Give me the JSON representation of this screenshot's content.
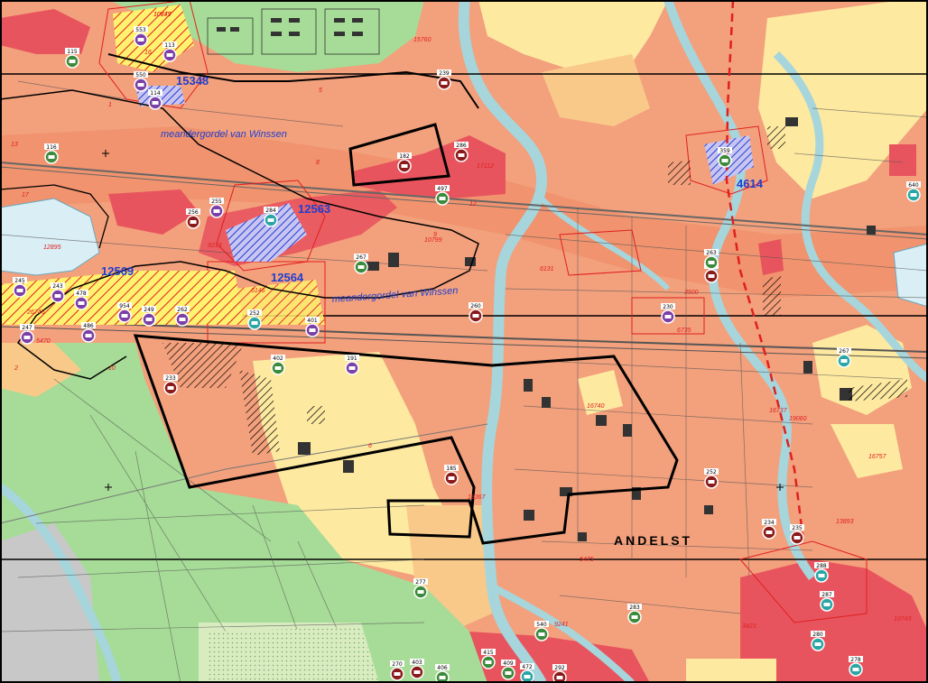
{
  "colors": {
    "zone_salmon": "#f3a07c",
    "zone_dark_salmon": "#ee8a66",
    "zone_red": "#e8545e",
    "zone_orange": "#f9c98a",
    "zone_yellow": "#fde9a0",
    "zone_green": "#a6dc97",
    "zone_light_green": "#c6e8b0",
    "zone_grey": "#c8c8c8",
    "water": "#a6d5dc",
    "lake": "#d9eef5",
    "marker_dark_red": "#8b1a1a",
    "marker_purple": "#7b3fa8",
    "marker_teal": "#2aa6a6",
    "marker_green": "#3c8a3c",
    "blue_label": "#1f3fd0",
    "red_label": "#e02020"
  },
  "labels": {
    "river_top": "meandergordel van Winssen",
    "river_mid": "meandergordel van Winssen",
    "town": "ANDELST",
    "ids": {
      "a": "15348",
      "b": "12563",
      "c": "12569",
      "d": "12564",
      "e": "4614"
    }
  },
  "markers": [
    {
      "id": "m1",
      "label": "115",
      "color": "marker_green"
    },
    {
      "id": "m2",
      "label": "553",
      "color": "marker_purple"
    },
    {
      "id": "m3",
      "label": "113",
      "color": "marker_purple"
    },
    {
      "id": "m4",
      "label": "550",
      "color": "marker_purple"
    },
    {
      "id": "m5",
      "label": "114",
      "color": "marker_purple"
    },
    {
      "id": "m6",
      "label": "239",
      "color": "marker_dark_red"
    },
    {
      "id": "m7",
      "label": "116",
      "color": "marker_green"
    },
    {
      "id": "m8",
      "label": "286",
      "color": "marker_dark_red"
    },
    {
      "id": "m9",
      "label": "256",
      "color": "marker_dark_red"
    },
    {
      "id": "m10",
      "label": "255",
      "color": "marker_purple"
    },
    {
      "id": "m11",
      "label": "284",
      "color": "marker_teal"
    },
    {
      "id": "m12",
      "label": "245",
      "color": "marker_purple"
    },
    {
      "id": "m13",
      "label": "243",
      "color": "marker_purple"
    },
    {
      "id": "m14",
      "label": "478",
      "color": "marker_purple"
    },
    {
      "id": "m15",
      "label": "954",
      "color": "marker_purple"
    },
    {
      "id": "m16",
      "label": "249",
      "color": "marker_purple"
    },
    {
      "id": "m17",
      "label": "262",
      "color": "marker_purple"
    },
    {
      "id": "m18",
      "label": "252",
      "color": "marker_teal"
    },
    {
      "id": "m19",
      "label": "401",
      "color": "marker_purple"
    },
    {
      "id": "m20",
      "label": "247",
      "color": "marker_purple"
    },
    {
      "id": "m21",
      "label": "486",
      "color": "marker_purple"
    },
    {
      "id": "m22",
      "label": "267",
      "color": "marker_green"
    },
    {
      "id": "m23",
      "label": "260",
      "color": "marker_dark_red"
    },
    {
      "id": "m24",
      "label": "230",
      "color": "marker_purple"
    },
    {
      "id": "m25",
      "label": "260",
      "color": "marker_dark_red"
    },
    {
      "id": "m26",
      "label": "402",
      "color": "marker_green"
    },
    {
      "id": "m27",
      "label": "191",
      "color": "marker_purple"
    },
    {
      "id": "m28",
      "label": "233",
      "color": "marker_dark_red"
    },
    {
      "id": "m29",
      "label": "263",
      "color": "marker_green"
    },
    {
      "id": "m30",
      "label": "359",
      "color": "marker_green"
    },
    {
      "id": "m31",
      "label": "267",
      "color": "marker_teal"
    },
    {
      "id": "m32",
      "label": "640",
      "color": "marker_teal"
    },
    {
      "id": "m33",
      "label": "277",
      "color": "marker_green"
    },
    {
      "id": "m34",
      "label": "252",
      "color": "marker_dark_red"
    },
    {
      "id": "m35",
      "label": "234",
      "color": "marker_dark_red"
    },
    {
      "id": "m36",
      "label": "235",
      "color": "marker_dark_red"
    },
    {
      "id": "m37",
      "label": "288",
      "color": "marker_teal"
    },
    {
      "id": "m38",
      "label": "287",
      "color": "marker_teal"
    },
    {
      "id": "m39",
      "label": "283",
      "color": "marker_green"
    },
    {
      "id": "m40",
      "label": "540",
      "color": "marker_green"
    },
    {
      "id": "m41",
      "label": "403",
      "color": "marker_dark_red"
    },
    {
      "id": "m42",
      "label": "406",
      "color": "marker_green"
    },
    {
      "id": "m43",
      "label": "415",
      "color": "marker_green"
    },
    {
      "id": "m44",
      "label": "409",
      "color": "marker_green"
    },
    {
      "id": "m45",
      "label": "472",
      "color": "marker_teal"
    },
    {
      "id": "m46",
      "label": "292",
      "color": "marker_dark_red"
    },
    {
      "id": "m47",
      "label": "270",
      "color": "marker_dark_red"
    },
    {
      "id": "m48",
      "label": "280",
      "color": "marker_teal"
    },
    {
      "id": "m49",
      "label": "278",
      "color": "marker_teal"
    },
    {
      "id": "m50",
      "label": "182",
      "color": "marker_dark_red"
    },
    {
      "id": "m51",
      "label": "497",
      "color": "marker_green"
    },
    {
      "id": "m52",
      "label": "185",
      "color": "marker_dark_red"
    }
  ],
  "red_numbers": [
    "10749",
    "15760",
    "17112",
    "1",
    "2",
    "10",
    "8",
    "13",
    "16",
    "17",
    "12",
    "9",
    "6",
    "5",
    "13893",
    "3500",
    "6131",
    "16737",
    "19060",
    "16757",
    "10743",
    "16740",
    "19367",
    "12895",
    "26745",
    "5470",
    "5475",
    "6146",
    "9213",
    "6735",
    "9241",
    "3423",
    "10799",
    "10677"
  ]
}
